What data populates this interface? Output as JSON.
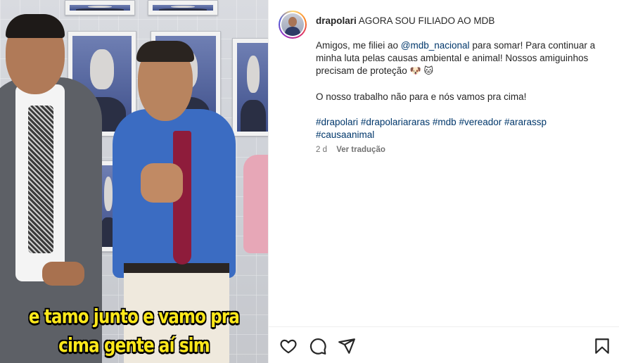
{
  "post": {
    "username": "drapolari",
    "title": "AGORA SOU FILIADO AO MDB",
    "body_line1_pre": "Amigos, me filiei ao ",
    "mention": "@mdb_nacional",
    "body_line1_post": " para somar! Para continuar a minha luta pelas causas ambiental e animal! Nossos amiguinhos precisam de proteção ",
    "emoji_dog": "🐶",
    "emoji_cat": "🐱",
    "body_para2": "O nosso trabalho não para e nós vamos pra cima!",
    "hashtags": [
      "#drapolari",
      "#drapolariararas",
      "#mdb",
      "#vereador",
      "#ararassp",
      "#causaanimal"
    ],
    "timestamp": "2 d",
    "translate_label": "Ver tradução"
  },
  "media": {
    "caption_line1": "e tamo junto e vamo pra",
    "caption_line2": "cima gente aí sim"
  },
  "actions": {
    "like_icon": "heart-icon",
    "comment_icon": "comment-icon",
    "share_icon": "send-icon",
    "save_icon": "bookmark-icon"
  },
  "colors": {
    "link": "#00376b",
    "caption": "#ffe81a",
    "muted": "#737373"
  }
}
